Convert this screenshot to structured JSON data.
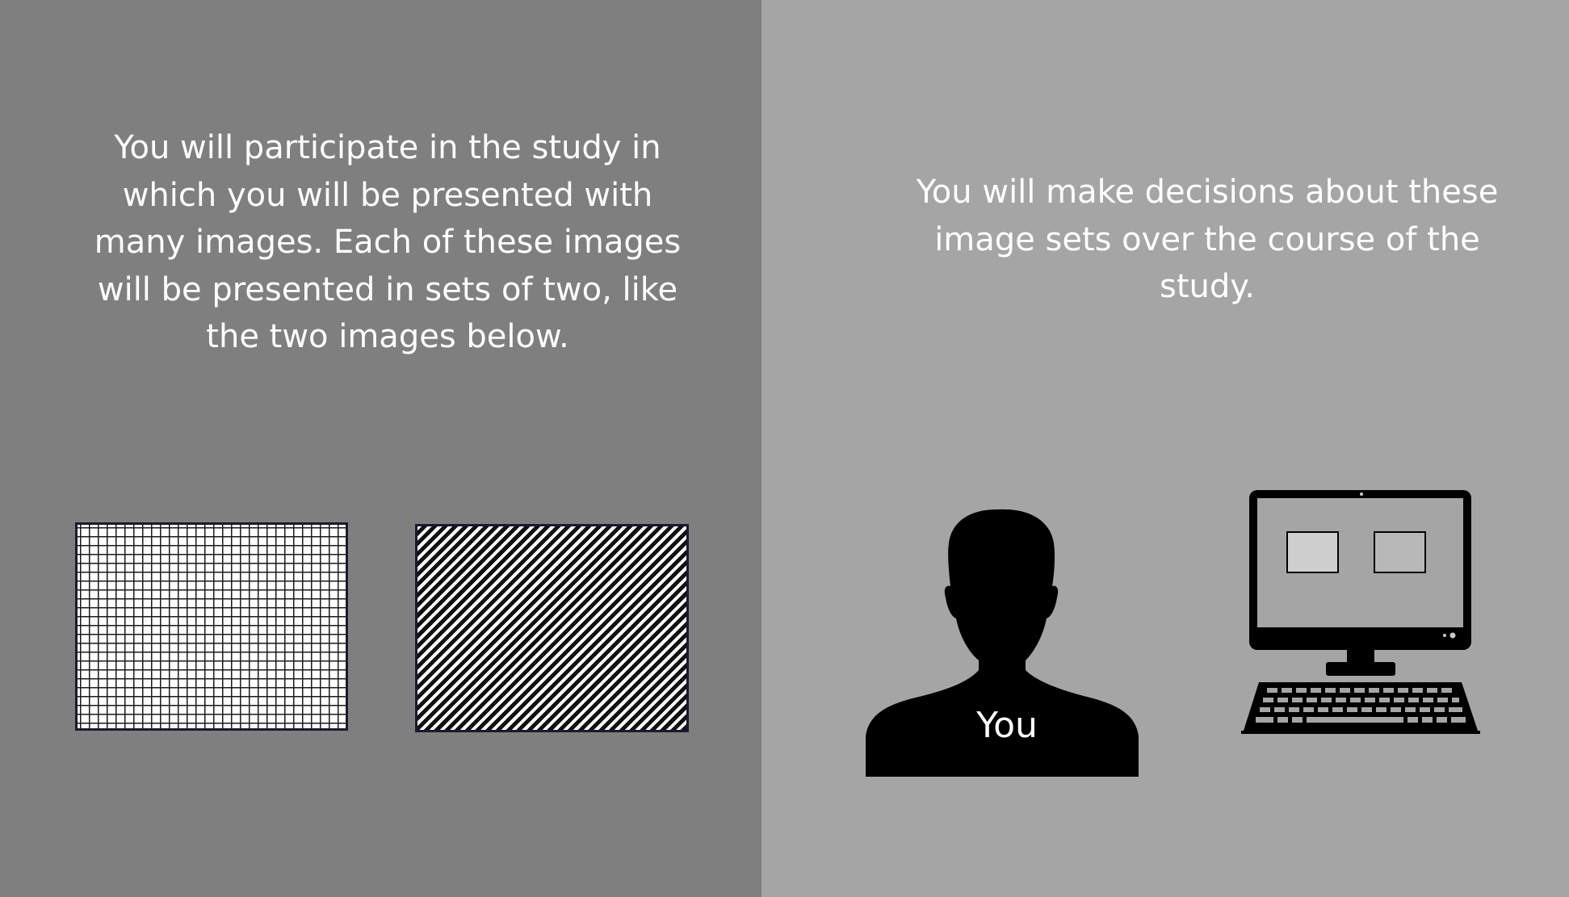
{
  "left_panel": {
    "instruction": "You will participate in the study in which you will be presented with many images. Each of these images will be presented in sets of two, like the two images below.",
    "color": "#7f7f7f",
    "stimuli": [
      {
        "name": "grid-pattern-image",
        "pattern": "grid"
      },
      {
        "name": "diagonal-stripe-image",
        "pattern": "diagonal-stripes"
      }
    ]
  },
  "right_panel": {
    "instruction": "You will make decisions about these image sets over the course of the study.",
    "color": "#a5a5a5",
    "participant_label": "You",
    "icons": [
      "person-silhouette-icon",
      "desktop-computer-icon"
    ]
  }
}
